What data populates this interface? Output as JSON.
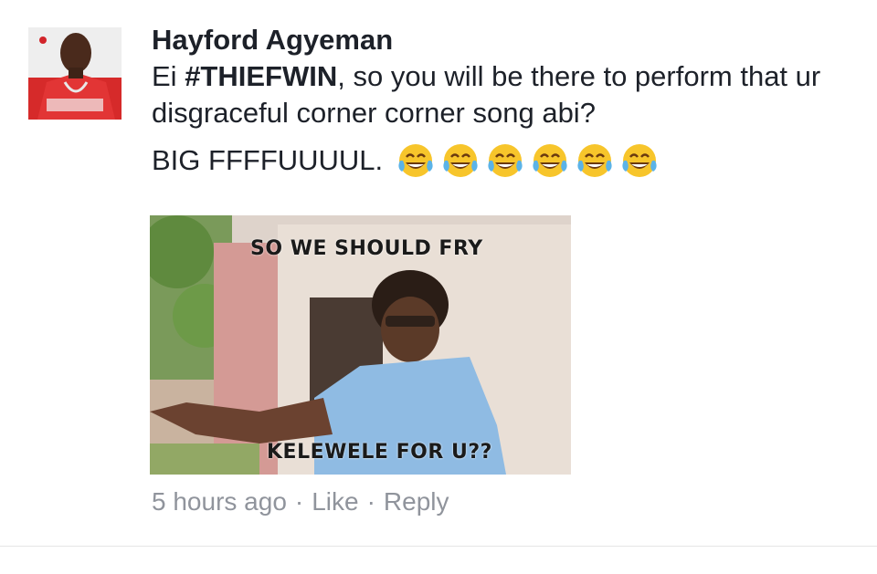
{
  "comment": {
    "author": "Hayford Agyeman",
    "text_prefix": "Ei ",
    "hashtag": "#THIEFWIN",
    "text_rest": ", so you will be there to perform that ur disgraceful corner corner song abi?",
    "line2_text": "BIG FFFFUUUUL.",
    "emoji": [
      "face-with-tears-of-joy-emoji",
      "face-with-tears-of-joy-emoji",
      "face-with-tears-of-joy-emoji",
      "face-with-tears-of-joy-emoji",
      "face-with-tears-of-joy-emoji",
      "face-with-tears-of-joy-emoji"
    ],
    "attachment": {
      "caption_top": "SO WE SHOULD FRY",
      "caption_bottom": "KELEWELE FOR U??"
    },
    "meta": {
      "time": "5 hours ago",
      "separator": "·",
      "like_label": "Like",
      "reply_label": "Reply"
    }
  },
  "colors": {
    "text": "#1d2129",
    "meta": "#90949c",
    "divider": "#e5e5e5"
  }
}
